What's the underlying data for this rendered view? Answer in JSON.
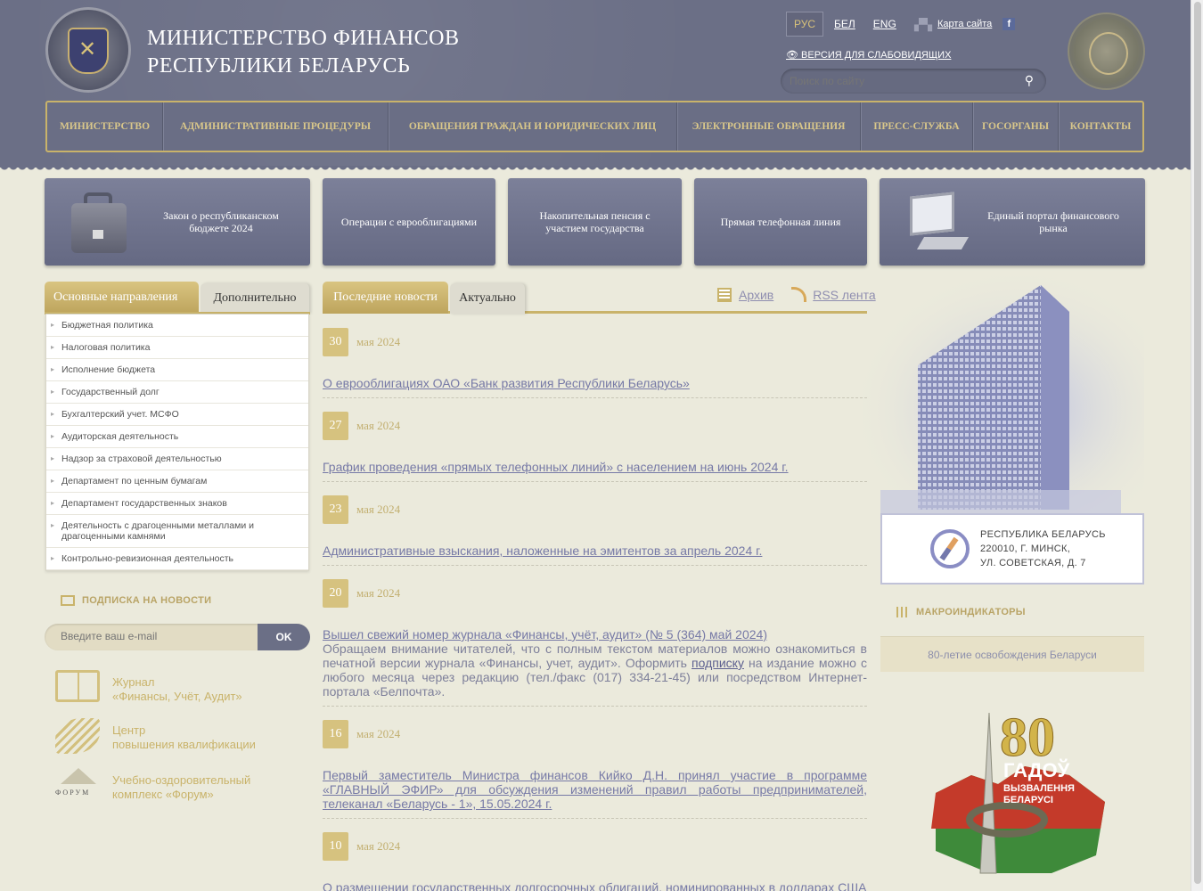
{
  "header": {
    "title_line1": "МИНИСТЕРСТВО ФИНАНСОВ",
    "title_line2": "РЕСПУБЛИКИ БЕЛАРУСЬ",
    "languages": [
      "РУС",
      "БЕЛ",
      "ENG"
    ],
    "active_language": "РУС",
    "sitemap_label": "Карта сайта",
    "low_vision_label": "ВЕРСИЯ ДЛЯ СЛАБОВИДЯЩИХ",
    "search_placeholder": "Поиск по сайту"
  },
  "nav": [
    "МИНИСТЕРСТВО",
    "АДМИНИСТРАТИВНЫЕ ПРОЦЕДУРЫ",
    "ОБРАЩЕНИЯ ГРАЖДАН И ЮРИДИЧЕСКИХ ЛИЦ",
    "ЭЛЕКТРОННЫЕ ОБРАЩЕНИЯ",
    "ПРЕСС-СЛУЖБА",
    "ГОСОРГАНЫ",
    "КОНТАКТЫ"
  ],
  "banners": {
    "budget_line1": "Закон о республиканском",
    "budget_line2": "бюджете 2024",
    "eurobonds": "Операции с еврооблигациями",
    "pension_line1": "Накопительная пенсия с",
    "pension_line2": "участием государства",
    "hotline": "Прямая телефонная линия",
    "portal_line1": "Единый портал финансового",
    "portal_line2": "рынка"
  },
  "left_tabs": {
    "main": "Основные направления",
    "extra": "Дополнительно"
  },
  "directions": [
    "Бюджетная политика",
    "Налоговая политика",
    "Исполнение бюджета",
    "Государственный долг",
    "Бухгалтерский учет. МСФО",
    "Аудиторская деятельность",
    "Надзор за страховой деятельностью",
    "Департамент по ценным бумагам",
    "Департамент государственных знаков",
    "Деятельность с драгоценными металлами и драгоценными камнями",
    "Контрольно-ревизионная деятельность"
  ],
  "subscribe": {
    "title": "ПОДПИСКА НА НОВОСТИ",
    "placeholder": "Введите ваш e-mail",
    "button": "OK"
  },
  "promo": {
    "journal_line1": "Журнал",
    "journal_line2": "«Финансы, Учёт, Аудит»",
    "center_line1": "Центр",
    "center_line2": "повышения квалификации",
    "forum_line1": "Учебно-оздоровительный",
    "forum_line2": "комплекс «Форум»",
    "forum_logo_text": "ФОРУМ"
  },
  "news_tabs": {
    "latest": "Последние новости",
    "actual": "Актуально"
  },
  "news_links": {
    "archive": "Архив",
    "rss": "RSS лента"
  },
  "news": [
    {
      "day": "30",
      "month": "мая 2024",
      "title": "О еврооблигациях ОАО «Банк развития Республики Беларусь»"
    },
    {
      "day": "27",
      "month": "мая 2024",
      "title": "График проведения «прямых телефонных линий» с населением на июнь 2024 г."
    },
    {
      "day": "23",
      "month": "мая 2024",
      "title": "Административные взыскания, наложенные на эмитентов за апрель 2024 г."
    },
    {
      "day": "20",
      "month": "мая 2024",
      "title": "Вышел свежий номер журнала «Финансы, учёт, аудит» (№ 5 (364) май 2024)",
      "text_before": "Обращаем внимание читателей, что с полным текстом материалов можно ознакомиться в печатной версии журнала «Финансы, учет, аудит». Оформить ",
      "text_link": "подписку",
      "text_after": " на издание можно с любого месяца через редакцию (тел./факс (017) 334-21-45) или посредством Интернет-портала «Белпочта»."
    },
    {
      "day": "16",
      "month": "мая 2024",
      "title": "Первый заместитель Министра финансов Кийко Д.Н. принял участие в программе «ГЛАВНЫЙ ЭФИР» для обсуждения изменений правил работы предпринимателей, телеканал «Беларусь - 1», 15.05.2024 г."
    },
    {
      "day": "10",
      "month": "мая 2024",
      "title": "О размещении государственных долгосрочных облигаций, номинированных в долларах США"
    }
  ],
  "address": {
    "line1": "РЕСПУБЛИКА БЕЛАРУСЬ",
    "line2": "220010, Г. МИНСК,",
    "line3": "УЛ. СОВЕТСКАЯ, Д. 7"
  },
  "macro_title": "МАКРОИНДИКАТОРЫ",
  "liberation_link": "80-летие освобождения Беларуси",
  "badge": {
    "number": "80",
    "line1": "ГАДОЎ",
    "line2": "ВЫЗВАЛЕННЯ",
    "line3": "БЕЛАРУСІ"
  },
  "colors": {
    "header": "#6b6f86",
    "gold": "#c9b36a",
    "background": "#ebeadc",
    "link": "#7679a6"
  }
}
